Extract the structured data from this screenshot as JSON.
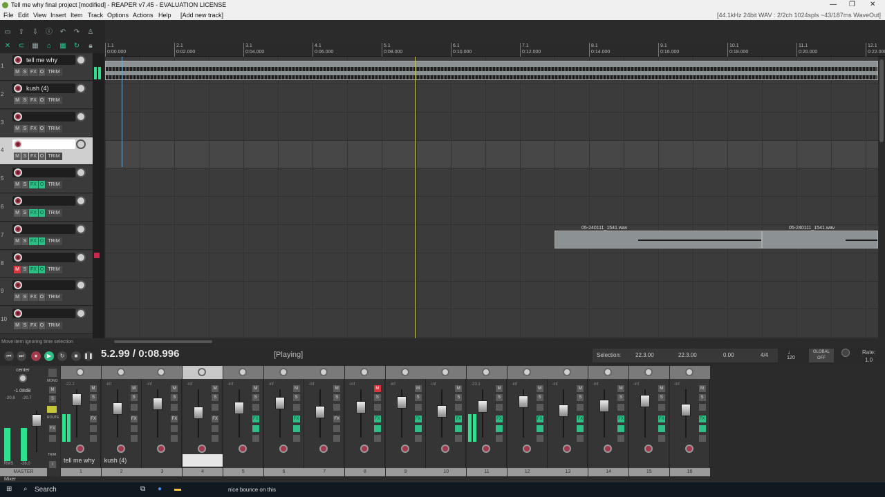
{
  "window": {
    "title": "Tell me why final project [modified] - REAPER v7.45 - EVALUATION LICENSE",
    "status": "[44.1kHz 24bit WAV : 2/2ch 1024spls ~43/187ms WaveOut]"
  },
  "menu": [
    "File",
    "Edit",
    "View",
    "Insert",
    "Item",
    "Track",
    "Options",
    "Actions",
    "Help",
    "[Add new track]"
  ],
  "ruler": [
    {
      "bar": "1.1",
      "time": "0:00.000"
    },
    {
      "bar": "2.1",
      "time": "0:02.000"
    },
    {
      "bar": "3.1",
      "time": "0:04.000"
    },
    {
      "bar": "4.1",
      "time": "0:06.000"
    },
    {
      "bar": "5.1",
      "time": "0:08.000"
    },
    {
      "bar": "6.1",
      "time": "0:10.000"
    },
    {
      "bar": "7.1",
      "time": "0:12.000"
    },
    {
      "bar": "8.1",
      "time": "0:14.000"
    },
    {
      "bar": "9.1",
      "time": "0:16.000"
    },
    {
      "bar": "10.1",
      "time": "0:18.000"
    },
    {
      "bar": "11.1",
      "time": "0:20.000"
    },
    {
      "bar": "12.1",
      "time": "0:22.000"
    }
  ],
  "tcp_labels": {
    "m": "M",
    "s": "S",
    "fx": "FX",
    "io": "O",
    "trim": "TRIM"
  },
  "tracks": [
    {
      "num": "1",
      "name": "tell me why",
      "fx_on": false,
      "muted": false
    },
    {
      "num": "2",
      "name": "kush (4)",
      "fx_on": false,
      "muted": false
    },
    {
      "num": "3",
      "name": "",
      "fx_on": false,
      "muted": false
    },
    {
      "num": "4",
      "name": "",
      "fx_on": false,
      "muted": false
    },
    {
      "num": "5",
      "name": "",
      "fx_on": true,
      "muted": false
    },
    {
      "num": "6",
      "name": "",
      "fx_on": true,
      "muted": false
    },
    {
      "num": "7",
      "name": "",
      "fx_on": true,
      "muted": false
    },
    {
      "num": "8",
      "name": "",
      "fx_on": true,
      "muted": true
    },
    {
      "num": "9",
      "name": "",
      "fx_on": false,
      "muted": false
    },
    {
      "num": "10",
      "name": "",
      "fx_on": false,
      "muted": false
    }
  ],
  "items": [
    {
      "label": "05-240111_1541.wav"
    },
    {
      "label": "05-240111_1541.wav"
    }
  ],
  "hint": "Move item ignoring time selection",
  "transport": {
    "position": "5.2.99 / 0:08.996",
    "state": "[Playing]"
  },
  "selection": {
    "label": "Selection:",
    "start": "22.3.00",
    "end": "22.3.00",
    "length": "0.00",
    "timesig": "4/4",
    "bpm": "120",
    "global": "GLOBAL",
    "global_state": "OFF",
    "rate_label": "Rate:",
    "rate": "1.0"
  },
  "master": {
    "label": "MASTER",
    "pan": "center",
    "db": "-1.08dB",
    "peak_l": "-20.8",
    "peak_r": "-20.7",
    "rms": "RMS",
    "rms_val": "-26.0",
    "mono": "MONO",
    "route": "ROUTE",
    "trim": "TRIM"
  },
  "mixer_strips": [
    {
      "num": "1",
      "name": "tell me why",
      "db": "-22.2"
    },
    {
      "num": "2",
      "name": "kush (4)",
      "db": "-inf"
    },
    {
      "num": "3",
      "name": "",
      "db": "-inf"
    },
    {
      "num": "4",
      "name": "",
      "db": "-inf"
    },
    {
      "num": "5",
      "name": "",
      "db": "-inf"
    },
    {
      "num": "6",
      "name": "",
      "db": "-inf"
    },
    {
      "num": "7",
      "name": "",
      "db": "-inf"
    },
    {
      "num": "8",
      "name": "",
      "db": "-inf"
    },
    {
      "num": "9",
      "name": "",
      "db": "-inf"
    },
    {
      "num": "10",
      "name": "",
      "db": "-inf"
    },
    {
      "num": "11",
      "name": "",
      "db": "-23.1"
    },
    {
      "num": "12",
      "name": "",
      "db": "-inf"
    },
    {
      "num": "13",
      "name": "",
      "db": "-inf"
    },
    {
      "num": "14",
      "name": "",
      "db": "-inf"
    },
    {
      "num": "15",
      "name": "",
      "db": "-inf"
    },
    {
      "num": "16",
      "name": "",
      "db": "-inf"
    }
  ],
  "mixer_tab": "Mixer",
  "taskbar": {
    "search": "Search",
    "notification": "nice bounce on this"
  }
}
